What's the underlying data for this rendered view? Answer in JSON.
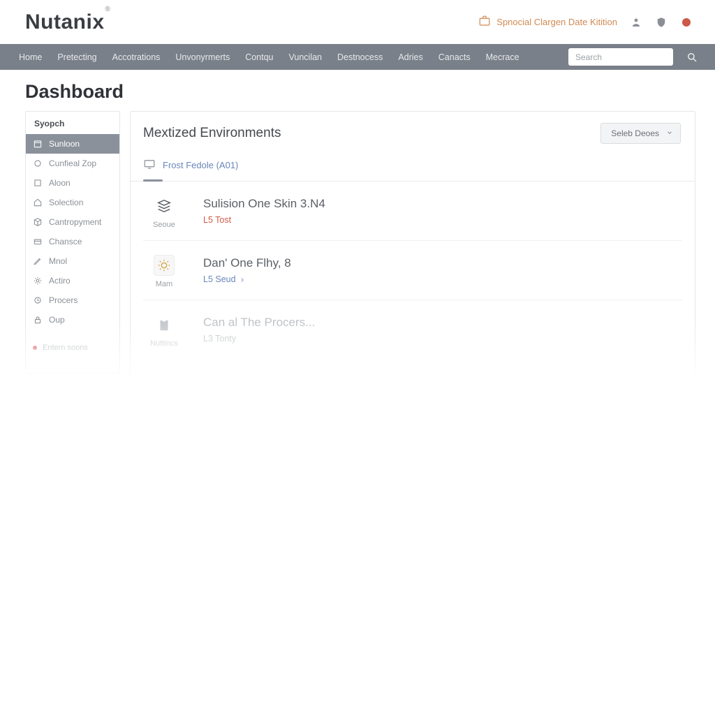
{
  "logo": "Nutanix",
  "top_notice": "Spnocial Clargen Date Kitition",
  "nav": {
    "items": [
      "Home",
      "Pretecting",
      "Accotrations",
      "Unvonyrmerts",
      "Contqu",
      "Vuncilan",
      "Destnocess",
      "Adries",
      "Canacts",
      "Mecrace"
    ],
    "search_placeholder": "Search"
  },
  "page_title": "Dashboard",
  "sidebar": {
    "heading": "Syopch",
    "items": [
      {
        "label": "Sunloon",
        "icon": "calendar"
      },
      {
        "label": "Cunfieal Zop",
        "icon": "circle"
      },
      {
        "label": "Aloon",
        "icon": "box"
      },
      {
        "label": "Solection",
        "icon": "home"
      },
      {
        "label": "Cantropyment",
        "icon": "cube"
      },
      {
        "label": "Chansce",
        "icon": "card"
      },
      {
        "label": "Mnol",
        "icon": "pencil"
      },
      {
        "label": "Actiro",
        "icon": "gear"
      },
      {
        "label": "Procers",
        "icon": "clock"
      },
      {
        "label": "Oup",
        "icon": "lock"
      }
    ],
    "footer": "Entern soons"
  },
  "panel": {
    "title": "Mextized Environments",
    "dropdown": "Seleb Deoes",
    "tab": "Frost Fedole (A01)",
    "rows": [
      {
        "badge_icon": "stack",
        "badge_label": "Seoue",
        "title": "Sulision One Skin 3.N4",
        "sub": "L5 Tost",
        "sub_style": "red",
        "boxed": false
      },
      {
        "badge_icon": "sun",
        "badge_label": "Mam",
        "title": "Dan' One Flhy, 8",
        "sub": "L5 Seud",
        "sub_style": "blue",
        "boxed": true,
        "arrow": true
      },
      {
        "badge_icon": "clipboard",
        "badge_label": "Nuttincs",
        "title": "Can al The Procers...",
        "sub": "L3 Tonty",
        "sub_style": "grey",
        "boxed": false,
        "faded": true
      }
    ]
  }
}
